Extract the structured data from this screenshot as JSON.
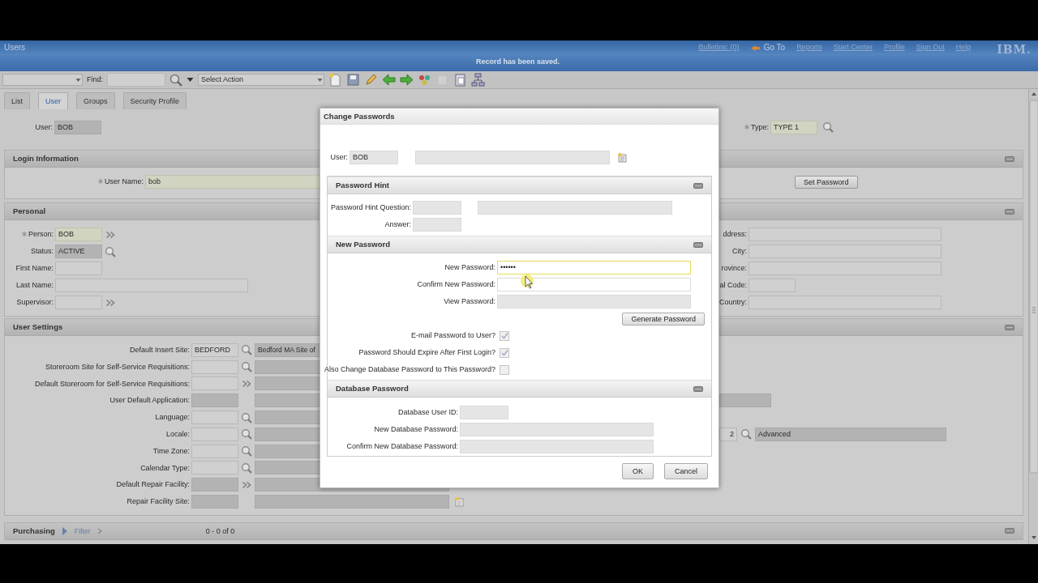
{
  "header": {
    "title": "Users",
    "message": "Record has been saved.",
    "links": [
      {
        "label": "Bulletins: (0)",
        "kind": "link"
      },
      {
        "label": "Go To",
        "kind": "menu"
      },
      {
        "label": "Reports",
        "kind": "link"
      },
      {
        "label": "Start Center",
        "kind": "link"
      },
      {
        "label": "Profile",
        "kind": "link"
      },
      {
        "label": "Sign Out",
        "kind": "link"
      },
      {
        "label": "Help",
        "kind": "link"
      }
    ],
    "logo": "IBM."
  },
  "toolbar": {
    "find_label": "Find:",
    "action": "Select Action"
  },
  "tabs": [
    {
      "label": "List",
      "selected": false
    },
    {
      "label": "User",
      "selected": true
    },
    {
      "label": "Groups",
      "selected": false
    },
    {
      "label": "Security Profile",
      "selected": false
    }
  ],
  "record": {
    "label": "User:",
    "value": "BOB",
    "type_label": "Type:",
    "type_value": "TYPE 1",
    "type_required": true
  },
  "sections": [
    {
      "title": "Login Information",
      "rows": [
        {
          "kind": "plain",
          "label": "User Name:",
          "value": "bob",
          "required": true,
          "readonly": false,
          "wide": true,
          "right": {
            "kind": "button",
            "label": "Set Password"
          }
        }
      ]
    },
    {
      "title": "Personal",
      "rows": [
        {
          "kind": "menu",
          "label": "Person:",
          "value": "BOB",
          "required": true,
          "readonly": false,
          "wide": false,
          "right": {
            "kind": "field",
            "label": "ddress:",
            "wide": true
          }
        },
        {
          "kind": "lookup",
          "label": "Status:",
          "value": "ACTIVE",
          "required": false,
          "readonly": true,
          "wide": false,
          "right": {
            "kind": "field",
            "label": "City:",
            "wide": true
          }
        },
        {
          "kind": "plain",
          "label": "First Name:",
          "required": false,
          "readonly": false,
          "wide": false,
          "right": {
            "kind": "field",
            "label": "rovince:",
            "wide": true
          }
        },
        {
          "kind": "plain",
          "label": "Last Name:",
          "required": false,
          "readonly": false,
          "wide": true,
          "right": {
            "kind": "field",
            "label": "al Code:",
            "wide": false
          }
        },
        {
          "kind": "menu",
          "label": "Supervisor:",
          "required": false,
          "readonly": false,
          "wide": false,
          "right": {
            "kind": "field",
            "label": "Country:",
            "wide": true
          }
        }
      ]
    },
    {
      "title": "User Settings",
      "rows": [
        {
          "kind": "lookup",
          "label": "Default Insert Site:",
          "value": "BEDFORD",
          "required": false,
          "readonly": false,
          "wide": false,
          "desc_field": true,
          "desc": "Bedford MA Site of"
        },
        {
          "kind": "lookup",
          "label": "Storeroom Site for Self-Service Requisitions:",
          "required": false,
          "readonly": false,
          "wide": false,
          "desc_field": true
        },
        {
          "kind": "menu",
          "label": "Default Storeroom for Self-Service Requisitions:",
          "required": false,
          "readonly": false,
          "wide": false,
          "desc_field": true
        },
        {
          "kind": "plain",
          "label": "User Default Application:",
          "required": false,
          "readonly": true,
          "wide": false,
          "desc_field": true,
          "right": {
            "kind": "partial"
          }
        },
        {
          "kind": "lookup",
          "label": "Language:",
          "required": false,
          "readonly": false,
          "wide": false,
          "desc_field": true
        },
        {
          "kind": "lookup",
          "label": "Locale:",
          "required": false,
          "readonly": false,
          "wide": false,
          "desc_field": true,
          "right": {
            "kind": "lookup",
            "value": "2",
            "desc": "Advanced"
          }
        },
        {
          "kind": "lookup",
          "label": "Time Zone:",
          "required": false,
          "readonly": false,
          "wide": false,
          "desc_field": true
        },
        {
          "kind": "lookup",
          "label": "Calendar Type:",
          "required": false,
          "readonly": false,
          "wide": false,
          "desc_field": true
        },
        {
          "kind": "menu",
          "label": "Default Repair Facility:",
          "required": false,
          "readonly": true,
          "wide": false,
          "desc_field": true
        },
        {
          "kind": "plain",
          "label": "Repair Facility Site:",
          "required": false,
          "readonly": true,
          "wide": false,
          "desc_field": true,
          "detail_button": true
        }
      ]
    }
  ],
  "purchasing": {
    "title": "Purchasing",
    "filter": "Filter",
    "count": "0 - 0 of 0"
  },
  "dialog": {
    "title": "Change Passwords",
    "user_label": "User:",
    "user_value": "BOB",
    "sections": [
      {
        "title": "Password Hint",
        "rows": [
          {
            "kind": "field",
            "label": "Password Hint Question:",
            "readonly": true,
            "focused": false,
            "wide": false,
            "desc_field": true
          },
          {
            "kind": "field",
            "label": "Answer:",
            "readonly": true,
            "focused": false,
            "wide": false
          }
        ]
      },
      {
        "title": "New Password",
        "rows": [
          {
            "kind": "field",
            "label": "New Password:",
            "value": "••••••",
            "readonly": false,
            "focused": true,
            "wide": true
          },
          {
            "kind": "field",
            "label": "Confirm New Password:",
            "readonly": false,
            "focused": false,
            "wide": true
          },
          {
            "kind": "field",
            "label": "View Password:",
            "readonly": true,
            "focused": false,
            "wide": true
          },
          {
            "kind": "button",
            "label": "Generate Password"
          },
          {
            "kind": "checkbox",
            "label": "E-mail Password to User?",
            "checked": true
          },
          {
            "kind": "checkbox",
            "label": "Password Should Expire After First Login?",
            "checked": true
          },
          {
            "kind": "checkbox",
            "label": "Also Change Database Password to This Password?",
            "checked": false
          }
        ]
      },
      {
        "title": "Database Password",
        "rows": [
          {
            "kind": "field",
            "label": "Database User ID:",
            "readonly": true,
            "focused": false,
            "wide": false
          },
          {
            "kind": "field",
            "label": "New Database Password:",
            "readonly": true,
            "focused": false,
            "wide": true
          },
          {
            "kind": "field",
            "label": "Confirm New Database Password:",
            "readonly": true,
            "focused": false,
            "wide": true
          }
        ]
      }
    ],
    "buttons": [
      "OK",
      "Cancel"
    ]
  }
}
